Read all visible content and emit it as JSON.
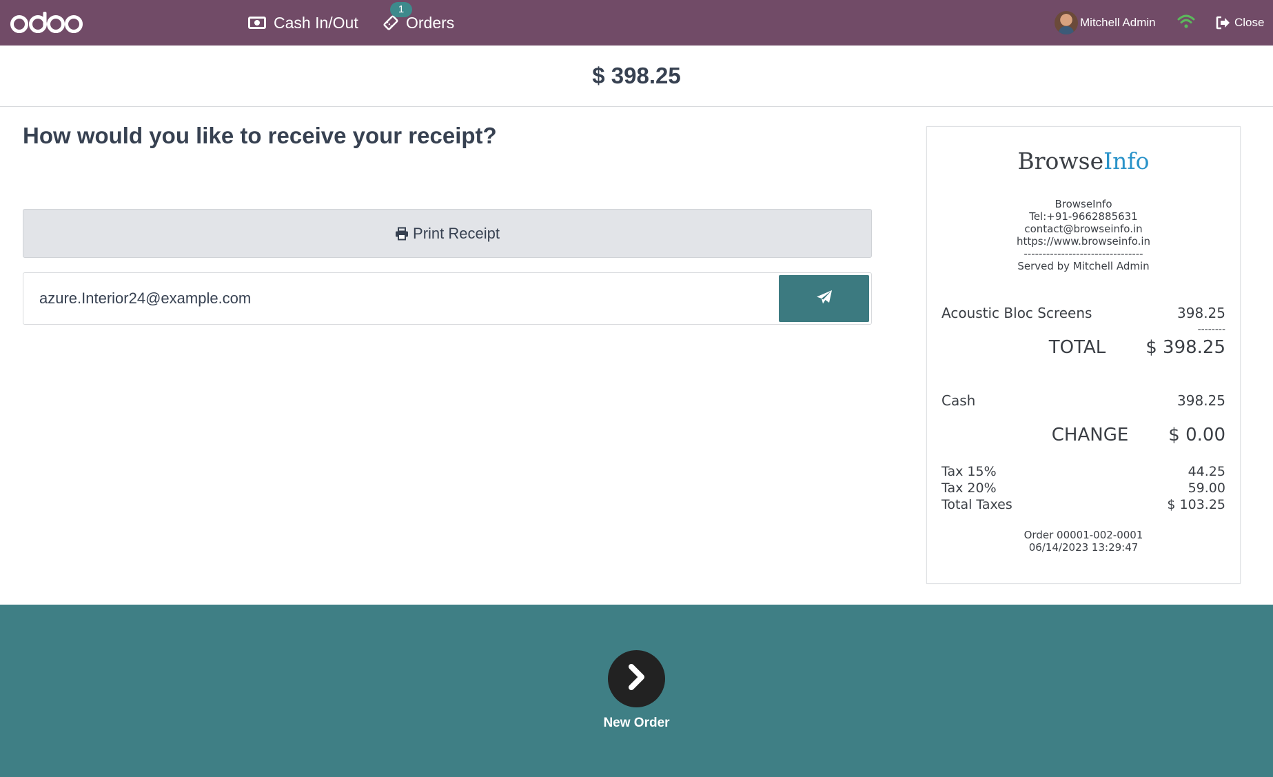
{
  "navbar": {
    "logo_text": "odoo",
    "cash_label": "Cash In/Out",
    "orders_label": "Orders",
    "orders_badge": "1",
    "user_name": "Mitchell Admin",
    "close_label": "Close",
    "colors": {
      "background": "#714b67",
      "badge": "#3d8a8c",
      "wifi": "#5cb85c"
    },
    "icons": [
      "money-icon",
      "ticket-icon",
      "avatar",
      "wifi-icon",
      "sign-out-icon"
    ]
  },
  "amount": "$ 398.25",
  "receipt_question": "How would you like to receive your receipt?",
  "print_button": "Print Receipt",
  "email": {
    "value": "azure.Interior24@example.com",
    "placeholder": "Email Receipt"
  },
  "receipt": {
    "brand_part1": "Browse",
    "brand_part2": "Info",
    "company_name": "BrowseInfo",
    "phone": "Tel:+91-9662885631",
    "email": "contact@browseinfo.in",
    "website": "https://www.browseinfo.in",
    "divider": "--------------------------------",
    "served_by": "Served by Mitchell Admin",
    "lines": [
      {
        "product": "Acoustic Bloc Screens",
        "price": "398.25"
      }
    ],
    "line_divider": "--------",
    "total_label": "TOTAL",
    "total_value": "$ 398.25",
    "payment_label": "Cash",
    "payment_value": "398.25",
    "change_label": "CHANGE",
    "change_value": "$ 0.00",
    "taxes": [
      {
        "label": "Tax 15%",
        "value": "44.25"
      },
      {
        "label": "Tax 20%",
        "value": "59.00"
      },
      {
        "label": "Total Taxes",
        "value": "$ 103.25"
      }
    ],
    "order_ref": "Order 00001-002-0001",
    "order_date": "06/14/2023 13:29:47"
  },
  "footer": {
    "next_label": "New Order",
    "color": "#3f7f85"
  }
}
